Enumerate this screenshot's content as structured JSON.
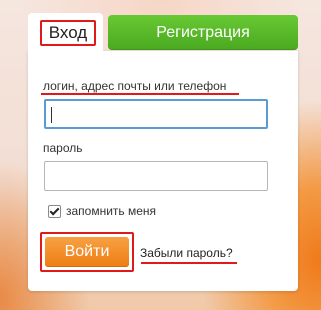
{
  "tabs": {
    "login_label": "Вход",
    "register_label": "Регистрация"
  },
  "form": {
    "login_field_label": "логин, адрес почты или телефон",
    "login_value": "",
    "password_label": "пароль",
    "password_value": "",
    "remember_label": "запомнить меня",
    "remember_checked": true,
    "submit_label": "Войти",
    "forgot_label": "Забыли пароль?"
  },
  "colors": {
    "register_green": "#4aa91f",
    "submit_orange": "#ee7d12",
    "highlight_red": "#e0191b",
    "focus_blue": "#5b9bd5"
  }
}
